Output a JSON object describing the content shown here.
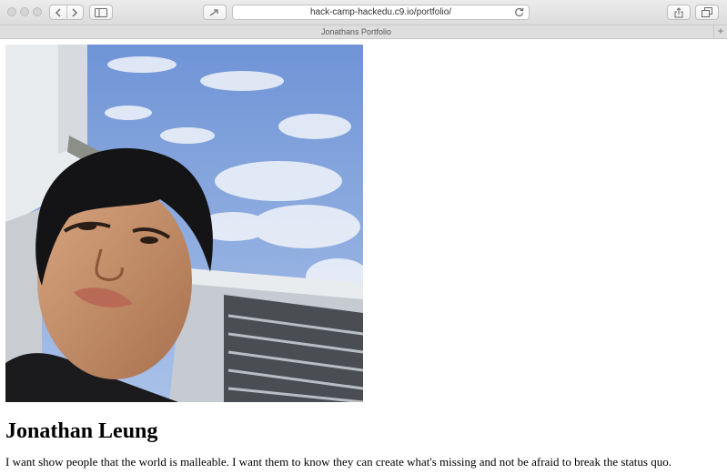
{
  "browser": {
    "url": "hack-camp-hackedu.c9.io/portfolio/",
    "tab_title": "Jonathans Portfolio",
    "new_tab_label": "+",
    "icons": {
      "close": "window-close-icon",
      "minimize": "window-minimize-icon",
      "zoom": "window-zoom-icon",
      "back": "chevron-left-icon",
      "forward": "chevron-right-icon",
      "sidebar": "sidebar-icon",
      "reader": "reader-icon",
      "reload": "reload-icon",
      "share": "share-icon",
      "tabs": "tabs-overview-icon"
    }
  },
  "page": {
    "name": "Jonathan Leung",
    "bio": "I want show people that the world is malleable. I want them to know they can create what's missing and not be afraid to break the status quo.",
    "photo": "profile-photo"
  },
  "colors": {
    "chrome": "#e4e4e4",
    "sky": "#7fa2dc",
    "page_bg": "#ffffff"
  }
}
